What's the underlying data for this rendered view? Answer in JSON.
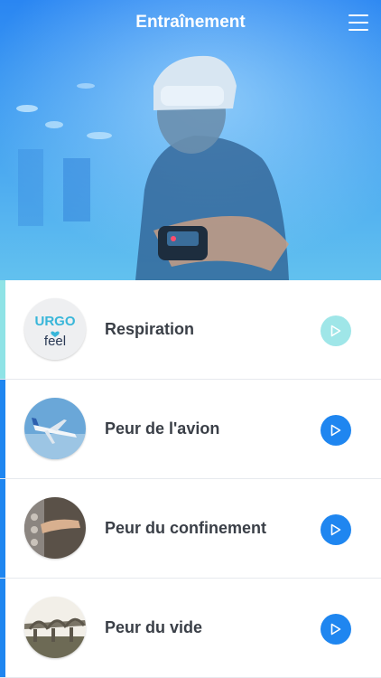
{
  "header": {
    "title": "Entraînement"
  },
  "items": [
    {
      "label": "Respiration",
      "accent": "#8fe3e6",
      "button_color": "#9fe6e8"
    },
    {
      "label": "Peur de l'avion",
      "accent": "#1f86f0",
      "button_color": "#1f86f0"
    },
    {
      "label": "Peur du confinement",
      "accent": "#1f86f0",
      "button_color": "#1f86f0"
    },
    {
      "label": "Peur du vide",
      "accent": "#1f86f0",
      "button_color": "#1f86f0"
    }
  ],
  "logo": {
    "line1": "URGO",
    "line2": "feel"
  },
  "icons": {
    "menu": "hamburger-menu-icon",
    "play": "play-icon"
  }
}
